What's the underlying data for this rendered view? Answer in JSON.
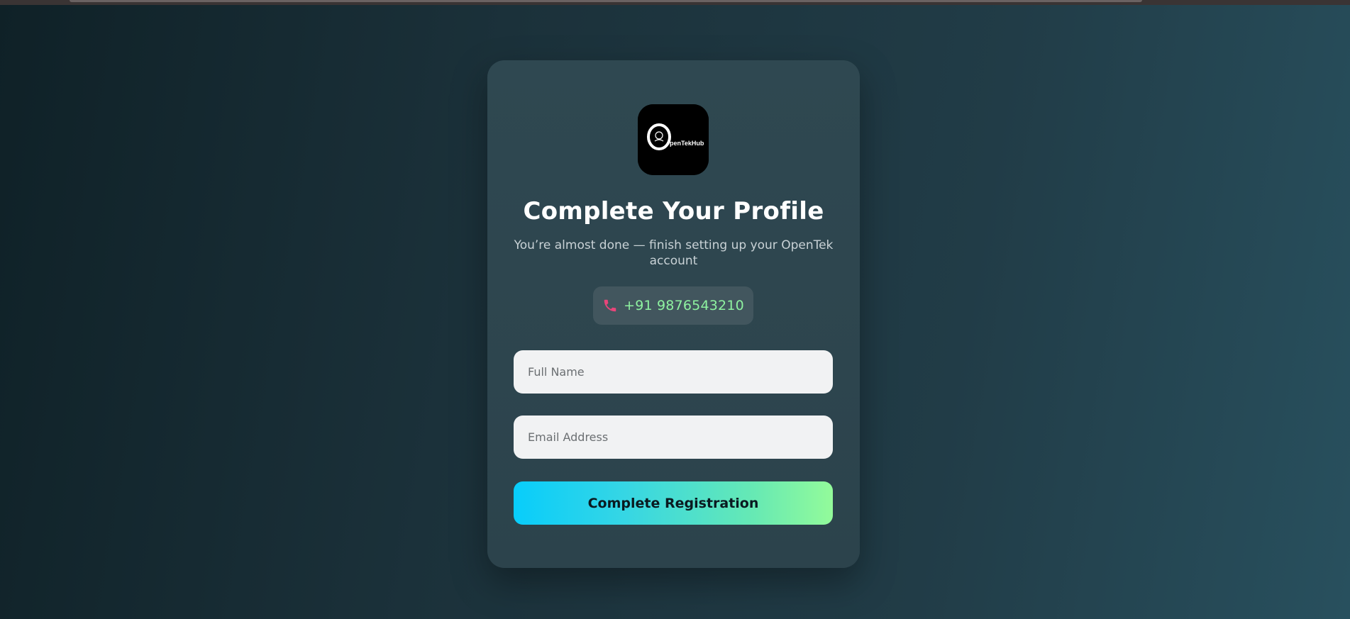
{
  "logo": {
    "letter": "O",
    "wordmark": "penTekHub"
  },
  "profile": {
    "title": "Complete Your Profile",
    "subtitle": "You’re almost done — finish setting up your OpenTek account",
    "phone_icon": "phone-icon",
    "phone": "+91 9876543210"
  },
  "form": {
    "full_name_placeholder": "Full Name",
    "full_name_value": "",
    "email_placeholder": "Email Address",
    "email_value": "",
    "submit_label": "Complete Registration"
  },
  "colors": {
    "phone_text": "#8ef2a0",
    "phone_icon": "#e8457a",
    "button_gradient_start": "#08cdfb",
    "button_gradient_end": "#93fb9a"
  }
}
